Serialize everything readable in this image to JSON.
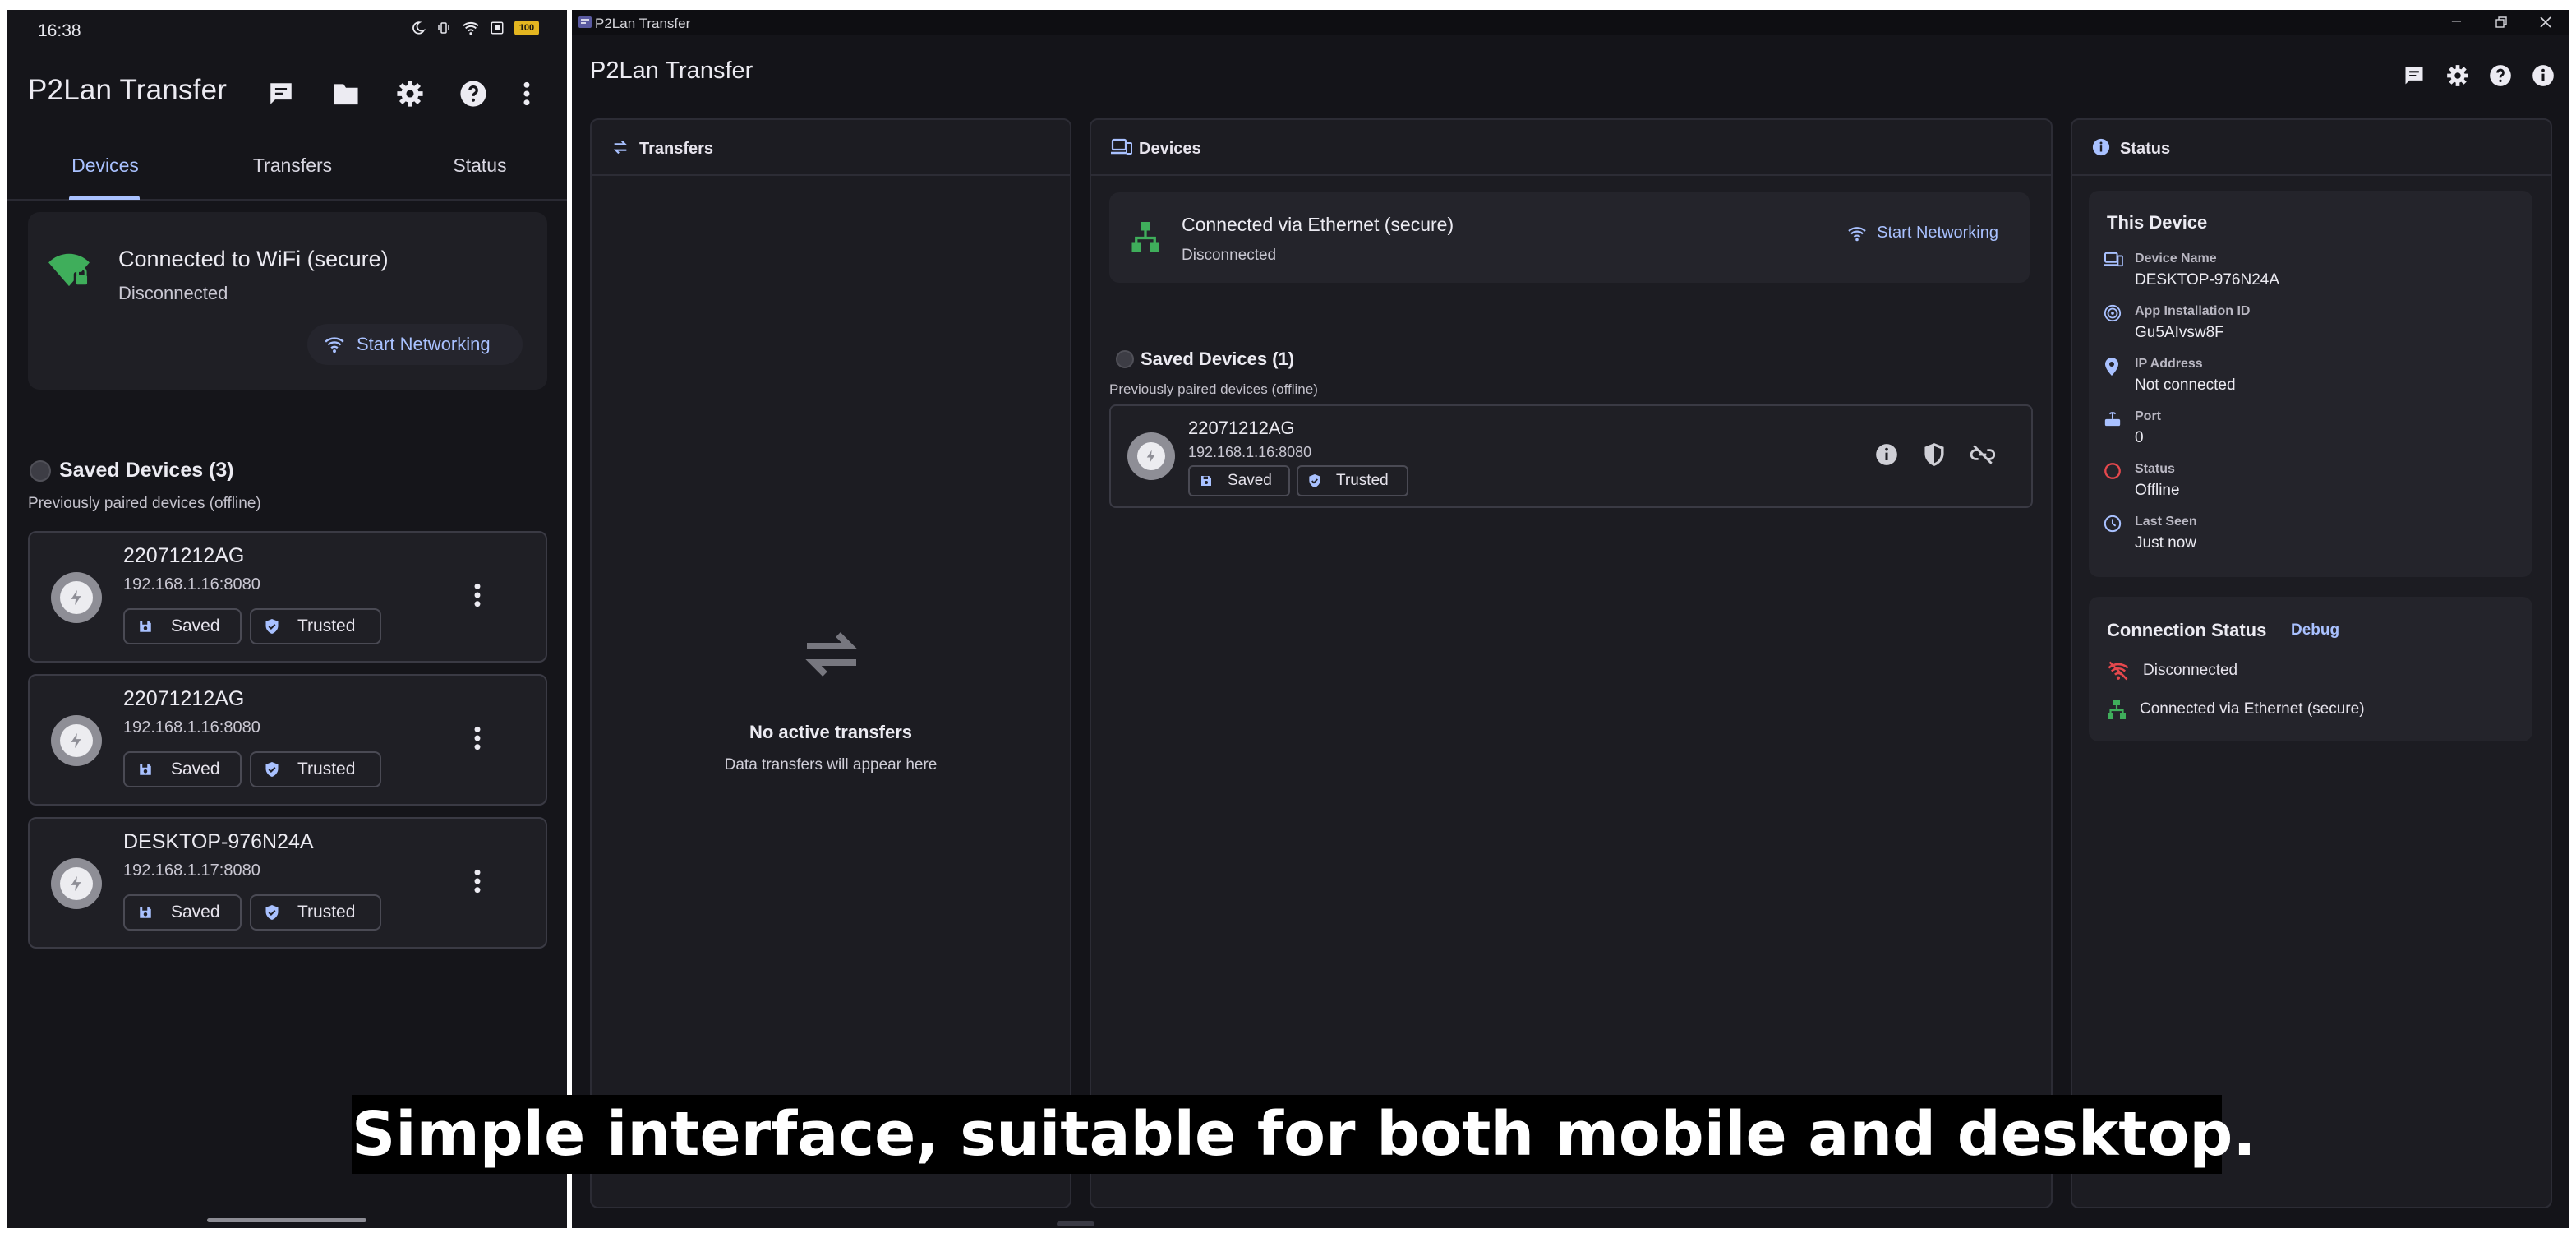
{
  "mobile": {
    "status_bar": {
      "time": "16:38",
      "battery": "100"
    },
    "app_title": "P2Lan Transfer",
    "tabs": [
      {
        "label": "Devices",
        "active": true
      },
      {
        "label": "Transfers",
        "active": false
      },
      {
        "label": "Status",
        "active": false
      }
    ],
    "connection": {
      "title": "Connected to WiFi (secure)",
      "state": "Disconnected",
      "start_button": "Start Networking"
    },
    "saved": {
      "title": "Saved Devices (3)",
      "subtitle": "Previously paired devices (offline)",
      "devices": [
        {
          "name": "22071212AG",
          "address": "192.168.1.16:8080",
          "saved_label": "Saved",
          "trusted_label": "Trusted"
        },
        {
          "name": "22071212AG",
          "address": "192.168.1.16:8080",
          "saved_label": "Saved",
          "trusted_label": "Trusted"
        },
        {
          "name": "DESKTOP-976N24A",
          "address": "192.168.1.17:8080",
          "saved_label": "Saved",
          "trusted_label": "Trusted"
        }
      ]
    }
  },
  "desktop": {
    "window_title": "P2Lan Transfer",
    "app_title": "P2Lan Transfer",
    "transfers": {
      "title": "Transfers",
      "empty_title": "No active transfers",
      "empty_subtitle": "Data transfers will appear here"
    },
    "devices": {
      "title": "Devices",
      "connection_title": "Connected via Ethernet (secure)",
      "connection_state": "Disconnected",
      "start_button": "Start Networking",
      "saved_title": "Saved Devices (1)",
      "saved_subtitle": "Previously paired devices (offline)",
      "device": {
        "name": "22071212AG",
        "address": "192.168.1.16:8080",
        "saved_label": "Saved",
        "trusted_label": "Trusted"
      }
    },
    "status": {
      "title": "Status",
      "this_device_title": "This Device",
      "rows": [
        {
          "label": "Device Name",
          "value": "DESKTOP-976N24A",
          "icon": "devices-icon"
        },
        {
          "label": "App Installation ID",
          "value": "Gu5AIvsw8F",
          "icon": "fingerprint-icon"
        },
        {
          "label": "IP Address",
          "value": "Not connected",
          "icon": "location-pin-icon"
        },
        {
          "label": "Port",
          "value": "0",
          "icon": "router-icon"
        },
        {
          "label": "Status",
          "value": "Offline",
          "icon": "status-ring-icon"
        },
        {
          "label": "Last Seen",
          "value": "Just now",
          "icon": "clock-icon"
        }
      ],
      "connection_status_title": "Connection Status",
      "debug_label": "Debug",
      "connection_rows": [
        {
          "text": "Disconnected",
          "icon": "wifi-off-icon"
        },
        {
          "text": "Connected via Ethernet (secure)",
          "icon": "ethernet-icon"
        }
      ]
    }
  },
  "caption": "Simple interface, suitable for both mobile and desktop.",
  "colors": {
    "accent": "#a9c1ff",
    "background": "#141419",
    "card": "#24242b",
    "wifi_green": "#3fae5b",
    "error_red": "#e5484d"
  }
}
